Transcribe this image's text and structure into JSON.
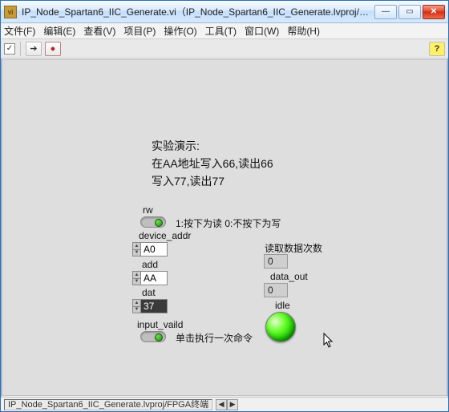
{
  "window": {
    "title": "IP_Node_Spartan6_IIC_Generate.vi（IP_Node_Spartan6_IIC_Generate.lvproj/FPGA终端"
  },
  "menu": {
    "file": "文件(F)",
    "edit": "编辑(E)",
    "view": "查看(V)",
    "project": "项目(P)",
    "operate": "操作(O)",
    "tools": "工具(T)",
    "window": "窗口(W)",
    "help": "帮助(H)"
  },
  "panel": {
    "demo_title": "实验演示:",
    "demo_line1": "在AA地址写入66,读出66",
    "demo_line2": "写入77,读出77",
    "rw_label": "rw",
    "rw_caption": "1:按下为读 0:不按下为写",
    "device_addr_label": "device_addr",
    "device_addr_value": "A0",
    "add_label": "add",
    "add_value": "AA",
    "dat_label": "dat",
    "dat_value": "37",
    "input_valid_label": "input_vaild",
    "input_valid_caption": "单击执行一次命令",
    "read_count_label": "读取数据次数",
    "read_count_value": "0",
    "data_out_label": "data_out",
    "data_out_value": "0",
    "idle_label": "idle"
  },
  "status": {
    "path": "IP_Node_Spartan6_IIC_Generate.lvproj/FPGA终端"
  }
}
